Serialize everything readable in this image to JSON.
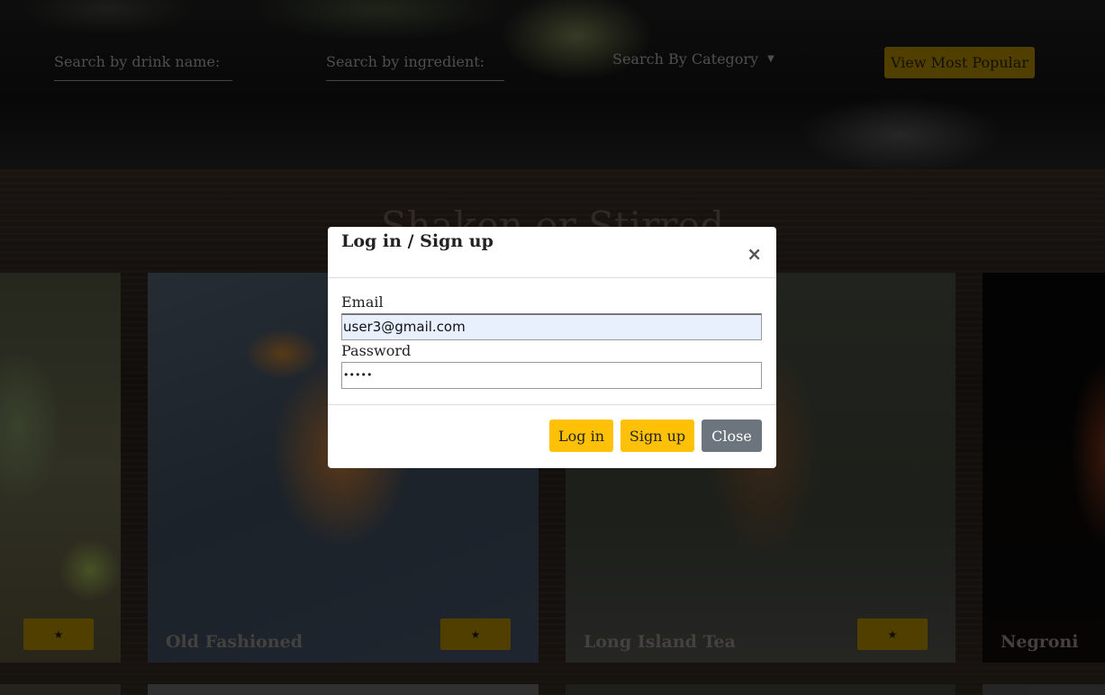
{
  "search": {
    "drink_placeholder": "Search by drink name:",
    "ingredient_placeholder": "Search by ingredient:",
    "category_label": "Search By Category",
    "category_caret": "▼",
    "popular_label": "View Most Popular"
  },
  "site_title": "Shaken or Stirred",
  "cards": [
    {
      "name": "",
      "fav_label": "★"
    },
    {
      "name": "Old Fashioned",
      "fav_label": "★"
    },
    {
      "name": "Long Island Tea",
      "fav_label": "★"
    },
    {
      "name": "Negroni",
      "fav_label": ""
    }
  ],
  "modal": {
    "title": "Log in / Sign up",
    "close_x": "×",
    "email_label": "Email",
    "email_value": "user3@gmail.com",
    "password_label": "Password",
    "password_value": "•••••",
    "login_label": "Log in",
    "signup_label": "Sign up",
    "close_label": "Close"
  },
  "colors": {
    "accent": "#ffc107",
    "accent_dimmed": "#7d6200",
    "close_button": "#6c757d"
  }
}
